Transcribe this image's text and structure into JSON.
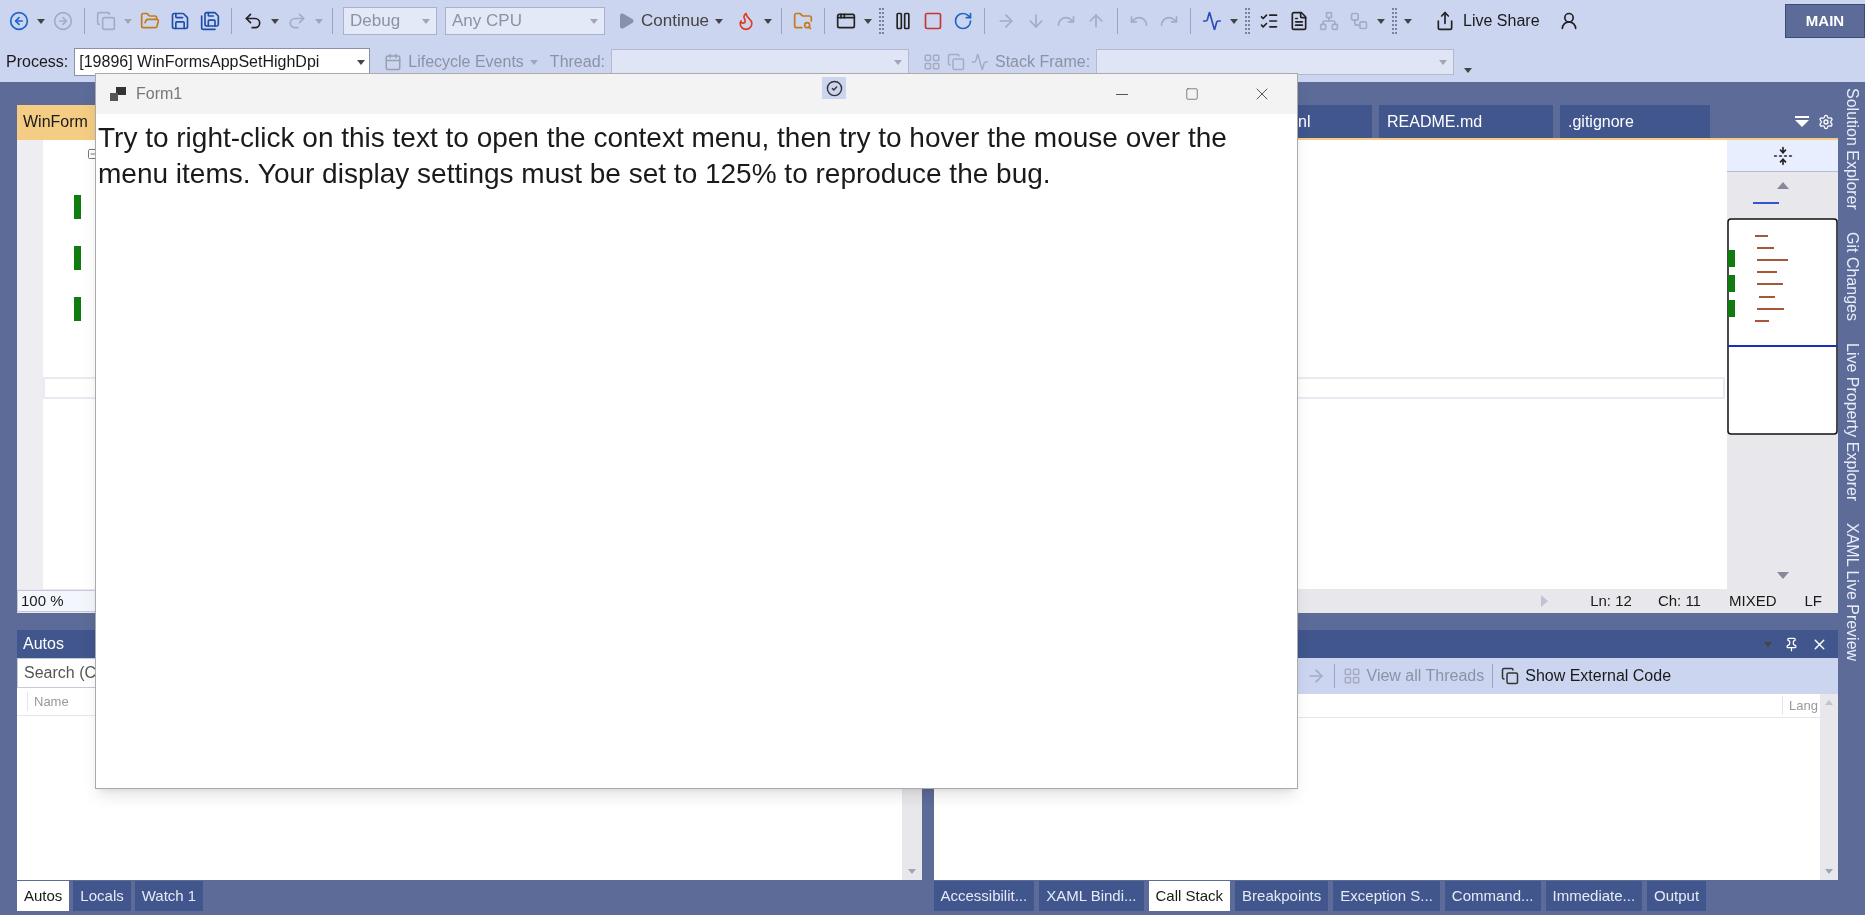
{
  "toolbar": [
    {
      "kind": "back",
      "disabled": false
    },
    {
      "kind": "caret",
      "disabled": false
    },
    {
      "kind": "forward",
      "disabled": true
    },
    {
      "kind": "separator"
    },
    {
      "kind": "new_item",
      "disabled": true
    },
    {
      "kind": "caret",
      "disabled": true
    },
    {
      "kind": "open",
      "disabled": false
    },
    {
      "kind": "save",
      "disabled": false
    },
    {
      "kind": "save_all",
      "disabled": false
    },
    {
      "kind": "separator"
    },
    {
      "kind": "undo",
      "disabled": false
    },
    {
      "kind": "caret",
      "disabled": false
    },
    {
      "kind": "redo",
      "disabled": true
    },
    {
      "kind": "caret",
      "disabled": true
    },
    {
      "kind": "separator"
    },
    {
      "kind": "combo",
      "label": "Debug",
      "disabled": true
    },
    {
      "kind": "combo",
      "label": "Any CPU",
      "disabled": true
    },
    {
      "kind": "continue",
      "label": "Continue",
      "disabled": false
    },
    {
      "kind": "hot_reload",
      "disabled": false
    },
    {
      "kind": "caret",
      "disabled": false
    },
    {
      "kind": "separator"
    },
    {
      "kind": "find_folder",
      "disabled": false
    },
    {
      "kind": "separator"
    },
    {
      "kind": "window",
      "disabled": false
    },
    {
      "kind": "caret",
      "disabled": false
    },
    {
      "kind": "grip"
    },
    {
      "kind": "pause",
      "disabled": false
    },
    {
      "kind": "stop",
      "disabled": false
    },
    {
      "kind": "restart",
      "disabled": false
    },
    {
      "kind": "separator"
    },
    {
      "kind": "next_statement",
      "disabled": true
    },
    {
      "kind": "step_into",
      "disabled": true
    },
    {
      "kind": "step_over",
      "disabled": true
    },
    {
      "kind": "step_out",
      "disabled": true
    },
    {
      "kind": "separator"
    },
    {
      "kind": "nav_back",
      "disabled": true
    },
    {
      "kind": "nav_forward",
      "disabled": true
    },
    {
      "kind": "separator"
    },
    {
      "kind": "diagnostics",
      "disabled": false
    },
    {
      "kind": "caret",
      "disabled": false
    },
    {
      "kind": "grip"
    },
    {
      "kind": "list",
      "disabled": false
    },
    {
      "kind": "document",
      "disabled": false
    },
    {
      "kind": "diagram",
      "disabled": true
    },
    {
      "kind": "flow",
      "disabled": true
    },
    {
      "kind": "caret",
      "disabled": false
    },
    {
      "kind": "grip"
    },
    {
      "kind": "caret",
      "disabled": false
    },
    {
      "kind": "live_share",
      "label": "Live Share",
      "disabled": false
    },
    {
      "kind": "feedback",
      "disabled": false
    },
    {
      "kind": "badge",
      "label": "MAIN"
    }
  ],
  "debug_location": {
    "process_label": "Process:",
    "process": "[19896] WinFormsAppSetHighDpi",
    "lifecycle": {
      "label": "Lifecycle Events",
      "disabled": true
    },
    "thread": {
      "label": "Thread:",
      "disabled": true
    },
    "stack_frame": {
      "label": "Stack Frame:",
      "disabled": true
    }
  },
  "document_tabs": [
    {
      "label": "WinForm",
      "selected": true
    },
    {
      "label": "nl",
      "selected": false
    },
    {
      "label": "README.md",
      "selected": false
    },
    {
      "label": ".gitignore",
      "selected": false
    }
  ],
  "editor_status": {
    "zoom": "100 %",
    "line": "Ln: 12",
    "column": "Ch: 11",
    "indentation": "MIXED",
    "line_endings": "LF"
  },
  "side_tabs": [
    "Solution Explorer",
    "Git Changes",
    "Live Property Explorer",
    "XAML Live Preview"
  ],
  "autos_panel": {
    "title": "Autos",
    "search_placeholder": "Search (C",
    "columns": [
      "Name"
    ]
  },
  "call_stack_panel": {
    "toolbar": [
      {
        "label": "View all Threads",
        "disabled": true
      },
      {
        "label": "Show External Code",
        "disabled": false
      }
    ],
    "columns": [
      "Lang"
    ]
  },
  "bottom_left_tabs": [
    {
      "label": "Autos",
      "selected": true
    },
    {
      "label": "Locals",
      "selected": false
    },
    {
      "label": "Watch 1",
      "selected": false
    }
  ],
  "bottom_right_tabs": [
    {
      "label": "Accessibilit...",
      "selected": false
    },
    {
      "label": "XAML Bindi...",
      "selected": false
    },
    {
      "label": "Call Stack",
      "selected": true
    },
    {
      "label": "Breakpoints",
      "selected": false
    },
    {
      "label": "Exception S...",
      "selected": false
    },
    {
      "label": "Command...",
      "selected": false
    },
    {
      "label": "Immediate...",
      "selected": false
    },
    {
      "label": "Output",
      "selected": false
    }
  ],
  "form_window": {
    "title": "Form1",
    "text": "Try to right-click on this text to open the context menu, then try to hover the mouse over the menu items. Your display settings must be set to 125% to reproduce the bug."
  }
}
